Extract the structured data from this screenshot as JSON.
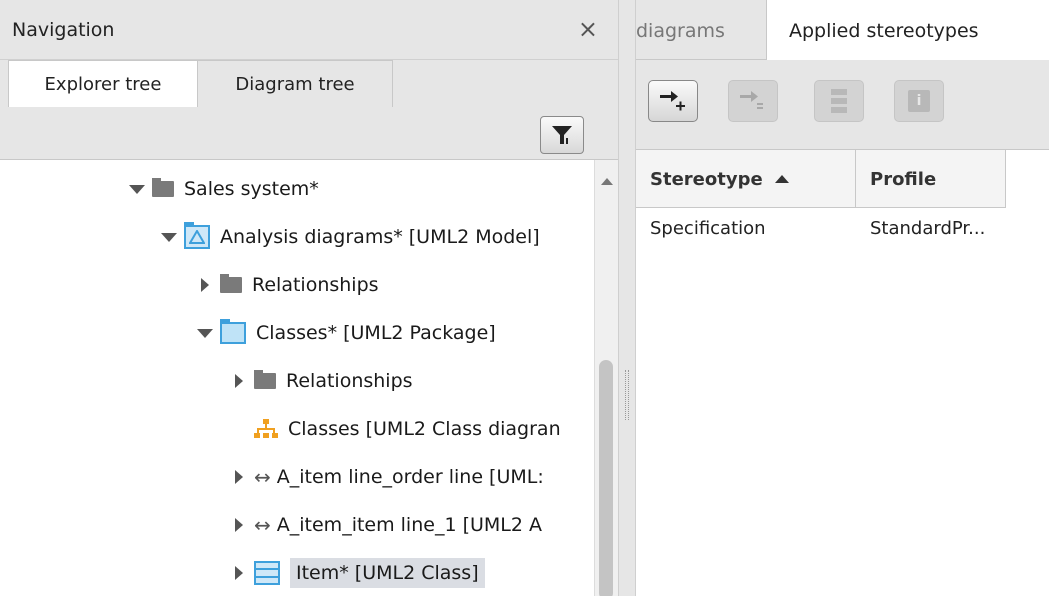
{
  "navigation": {
    "title": "Navigation",
    "close_glyph": "×",
    "tabs": [
      {
        "label": "Explorer tree",
        "active": true
      },
      {
        "label": "Diagram tree",
        "active": false
      }
    ],
    "filter_icon": "filter-icon",
    "tree": [
      {
        "label": "Sales system*",
        "icon": "folder-icon",
        "toggle": "expanded",
        "level": 0
      },
      {
        "label": "Analysis diagrams* [UML2 Model]",
        "icon": "model-icon",
        "toggle": "expanded",
        "level": 1
      },
      {
        "label": "Relationships",
        "icon": "folder-icon",
        "toggle": "collapsed",
        "level": 2
      },
      {
        "label": "Classes* [UML2 Package]",
        "icon": "package-icon",
        "toggle": "expanded",
        "level": 2
      },
      {
        "label": "Relationships",
        "icon": "folder-icon",
        "toggle": "collapsed",
        "level": 3
      },
      {
        "label": "Classes [UML2 Class diagran",
        "icon": "class-diagram-icon",
        "toggle": "none",
        "level": 3
      },
      {
        "label": "A_item line_order line [UML:",
        "icon": "association-icon",
        "toggle": "collapsed",
        "level": 3
      },
      {
        "label": "A_item_item line_1 [UML2 A",
        "icon": "association-icon",
        "toggle": "collapsed",
        "level": 3
      },
      {
        "label": "Item* [UML2 Class]",
        "icon": "class-icon",
        "toggle": "collapsed",
        "level": 3,
        "selected": true
      }
    ]
  },
  "right_panel": {
    "tabs": [
      {
        "label": "diagrams",
        "active": false
      },
      {
        "label": "Applied stereotypes",
        "active": true
      }
    ],
    "toolbar": [
      {
        "icon": "add-stereotype-icon",
        "enabled": true
      },
      {
        "icon": "remove-stereotype-icon",
        "enabled": false
      },
      {
        "icon": "stack-icon",
        "enabled": false
      },
      {
        "icon": "info-icon",
        "enabled": false
      }
    ],
    "table": {
      "columns": [
        "Stereotype",
        "Profile"
      ],
      "rows": [
        [
          "Specification",
          "StandardPr..."
        ]
      ]
    }
  },
  "colors": {
    "panel_bg": "#e6e6e6",
    "accent_blue": "#3ea0dc",
    "class_diagram_orange": "#f0a020",
    "selection": "#dadde3"
  }
}
